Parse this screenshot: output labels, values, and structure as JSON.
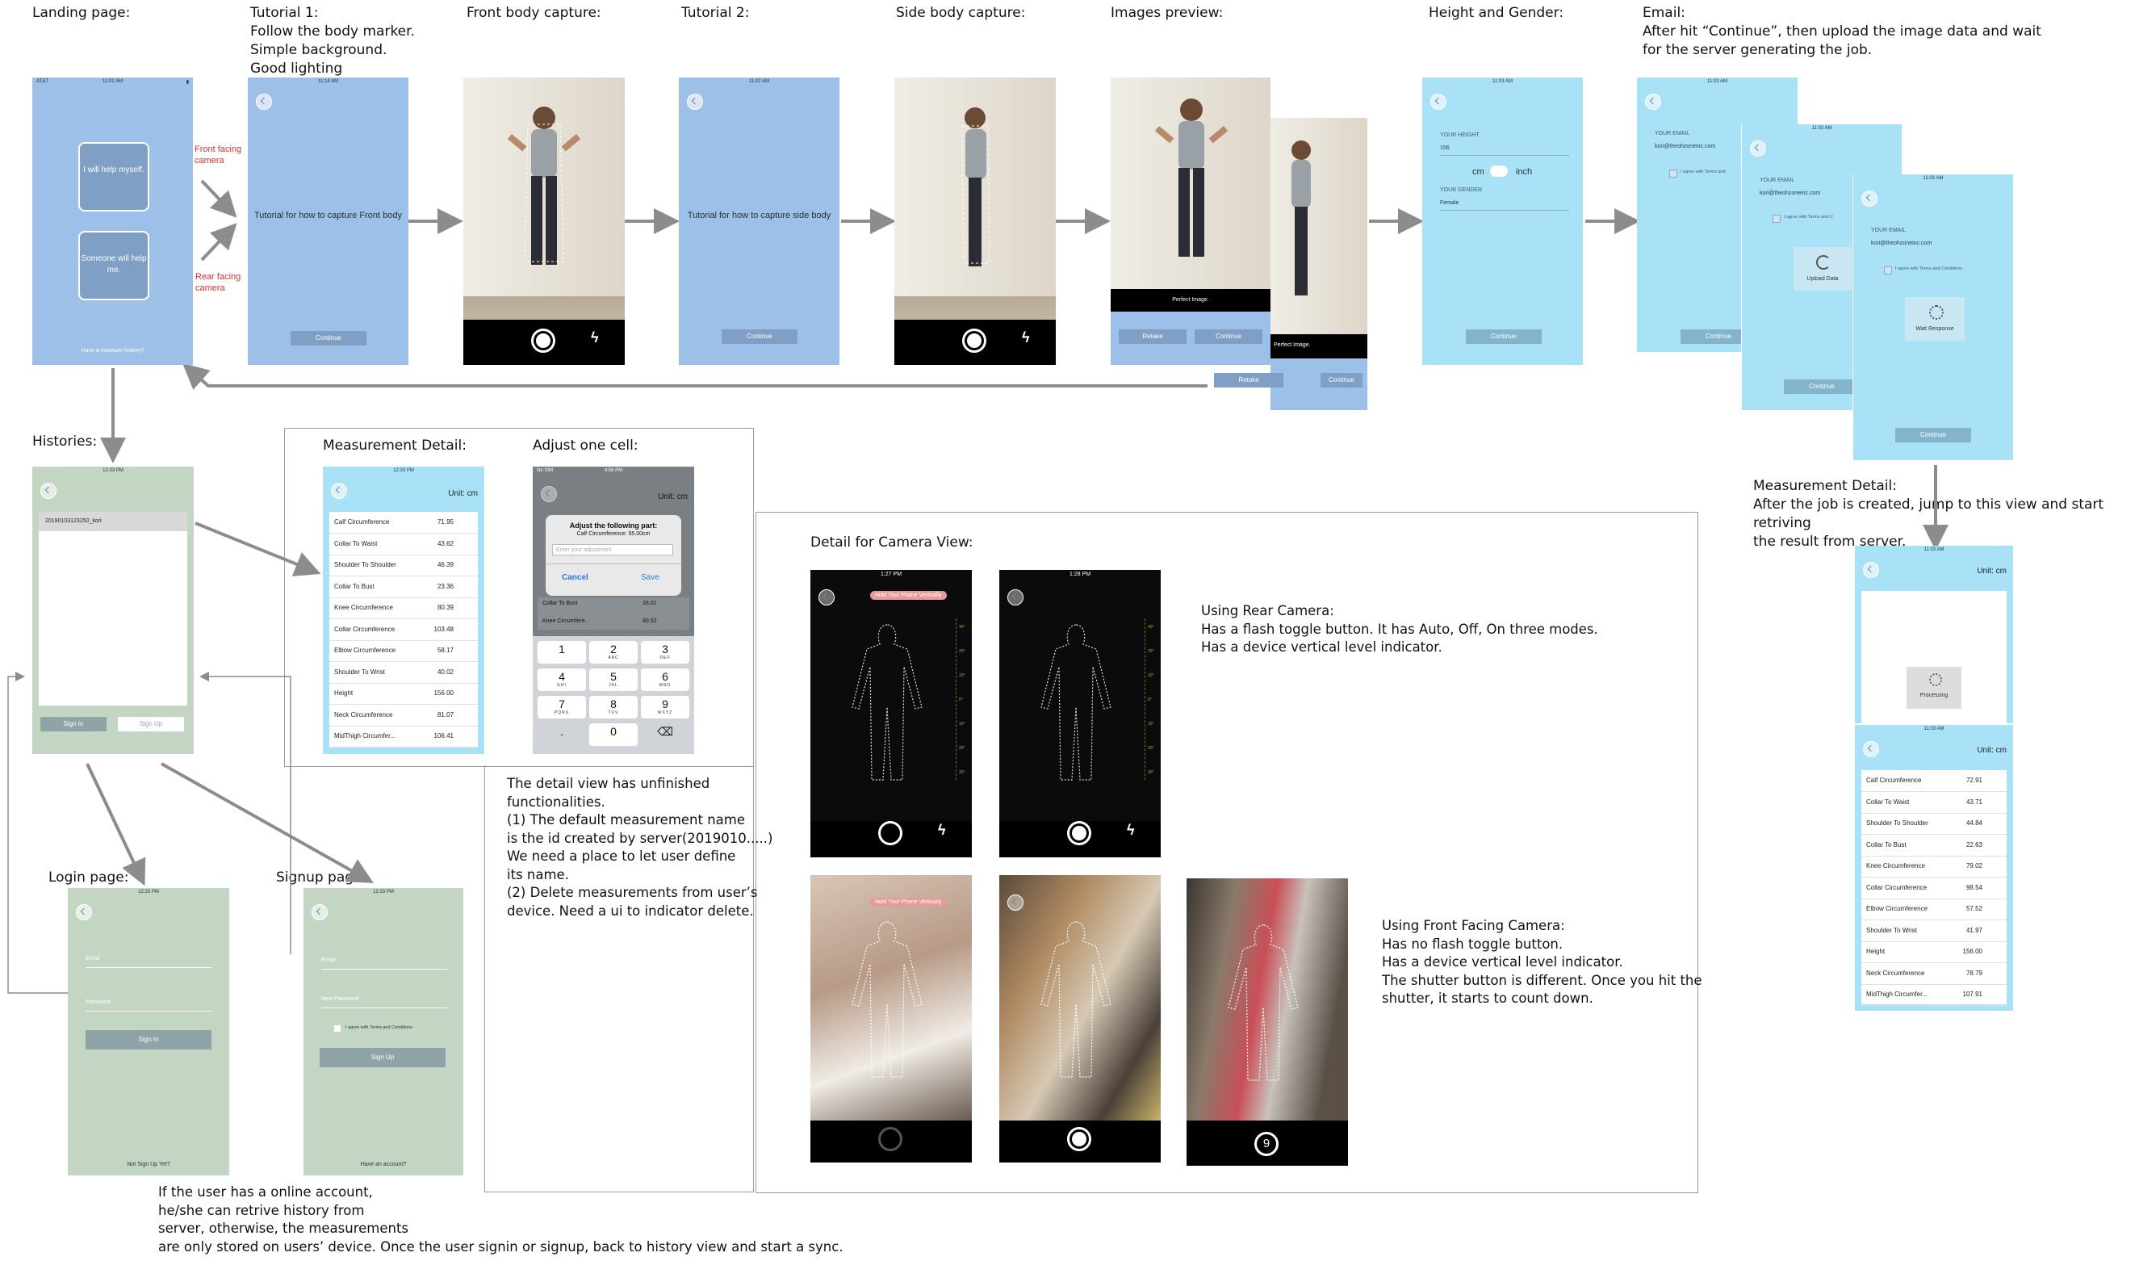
{
  "labels": {
    "landing": "Landing page:",
    "tutorial1": "Tutorial 1:\nFollow the body marker.\nSimple background.\nGood lighting",
    "front_capture": "Front body capture:",
    "tutorial2": "Tutorial 2:",
    "side_capture": "Side body capture:",
    "images_preview": "Images preview:",
    "height_gender": "Height and Gender:",
    "email": "Email:\nAfter hit “Continue”, then upload the image data and wait\nfor the server generating the job.",
    "histories": "Histories:",
    "measurement_detail": "Measurement Detail:",
    "adjust_cell": "Adjust one cell:",
    "camera_detail": "Detail for Camera View:",
    "measurement_detail_right": "Measurement Detail:\nAfter the job is created, jump to this view and start retriving\nthe result from server.",
    "login": "Login page:",
    "signup": "Signup page:",
    "front_facing": "Front facing\ncamera",
    "rear_facing": "Rear facing\ncamera"
  },
  "notes": {
    "detail_view": "The detail view has unfinished\nfunctionalities.\n(1) The default measurement name\nis the id created by server(2019010.....)\nWe need a place to let user define\nits name.\n(2) Delete measurements from user’s\ndevice. Need a ui to indicator delete.",
    "rear_camera": "Using Rear Camera:\nHas a flash toggle button. It has Auto, Off, On three modes.\nHas a device vertical level indicator.",
    "front_camera": "Using Front Facing Camera:\nHas no flash toggle button.\nHas a device vertical level indicator.\nThe shutter button is different. Once you hit the\nshutter, it starts to count down.",
    "online_account": "If the user has a online account,\nhe/she can retrive history from\nserver, otherwise, the measurements\nare only stored on users’ device. Once the user signin or signup, back to history view and start a sync."
  },
  "landing_screen": {
    "status_carrier": "AT&T",
    "status_time": "11:01 AM",
    "help_myself": "I will help\nmyself.",
    "someone_help": "Someone will\nhelp me.",
    "footer": "Have a measure history?"
  },
  "tutorial1_screen": {
    "status_time": "11:14 AM",
    "text": "Tutorial for how to\ncapture Front body",
    "button": "Continue"
  },
  "tutorial2_screen": {
    "status_time": "11:02 AM",
    "text": "Tutorial for how to\ncapture side body",
    "button": "Continue"
  },
  "front_capture_screen": {
    "status_time": "11:07 AM"
  },
  "side_capture_screen": {
    "status_time": "11:03 AM"
  },
  "preview_screen": {
    "caption": "Perfect Image.",
    "retake": "Retake",
    "continue": "Continue",
    "caption2": "Perfect Image.",
    "retake2": "Retake",
    "continue2": "Continue"
  },
  "height_screen": {
    "status_time": "11:03 AM",
    "height_label": "YOUR HEIGHT",
    "height_value": "156",
    "unit_cm": "cm",
    "unit_inch": "inch",
    "gender_label": "YOUR GENDER",
    "gender_value": "Female",
    "button": "Continue"
  },
  "email_screens": {
    "status_time": "11:03 AM",
    "email_label": "YOUR EMAIL",
    "email_value": "kori@theohzoneinc.com",
    "agree": "I agree with Terms and Conditions",
    "agree_short": "I agree with Terms and",
    "agree_mid": "I agree with Terms and C",
    "upload": "Upload Data",
    "wait": "Wait Response",
    "button": "Continue"
  },
  "histories_screen": {
    "status_time": "12:33 PM",
    "item": "20190103123250_kori",
    "sign_in": "Sign In",
    "sign_up": "Sign Up"
  },
  "measurement_screen": {
    "status_time": "12:33 PM",
    "unit": "Unit:  cm",
    "rows": [
      {
        "name": "Calf Circumference",
        "value": "71.95"
      },
      {
        "name": "Collar To Waist",
        "value": "43.62"
      },
      {
        "name": "Shoulder To Shoulder",
        "value": "46.39"
      },
      {
        "name": "Collar To Bust",
        "value": "23.36"
      },
      {
        "name": "Knee Circumference",
        "value": "80.39"
      },
      {
        "name": "Collar Circumference",
        "value": "103.48"
      },
      {
        "name": "Elbow Circumference",
        "value": "58.17"
      },
      {
        "name": "Shoulder To Wrist",
        "value": "40.02"
      },
      {
        "name": "Height",
        "value": "156.00"
      },
      {
        "name": "Neck Circumference",
        "value": "81.07"
      },
      {
        "name": "MidThigh Circumfer...",
        "value": "106.41"
      }
    ]
  },
  "adjust_screen": {
    "status_carrier": "No SIM",
    "status_time": "4:56 PM",
    "unit": "Unit:  cm",
    "title": "Adjust the following part:",
    "subtitle": "Calf Circumference: 55.00cm",
    "placeholder": "Enter your adjustment",
    "cancel": "Cancel",
    "save": "Save",
    "row1_name": "Collar To Bust",
    "row1_value": "28.01",
    "row2_name": "Knee Circumfere...",
    "row2_value": "80.52",
    "keys": [
      {
        "n": "1",
        "l": ""
      },
      {
        "n": "2",
        "l": "ABC"
      },
      {
        "n": "3",
        "l": "DEF"
      },
      {
        "n": "4",
        "l": "GHI"
      },
      {
        "n": "5",
        "l": "JKL"
      },
      {
        "n": "6",
        "l": "MNO"
      },
      {
        "n": "7",
        "l": "PQRS"
      },
      {
        "n": "8",
        "l": "TUV"
      },
      {
        "n": "9",
        "l": "WXYZ"
      },
      {
        "n": ".",
        "l": ""
      },
      {
        "n": "0",
        "l": ""
      },
      {
        "n": "⌫",
        "l": ""
      }
    ]
  },
  "camera_views": {
    "time1": "1:27 PM",
    "time2": "1:28 PM",
    "hold_msg": "Hold Your Phone Vertically",
    "countdown": "9",
    "ticks": [
      "30°",
      "20°",
      "10°",
      "0°",
      "10°",
      "20°",
      "30°"
    ]
  },
  "processing_screen": {
    "status_time": "11:03 AM",
    "unit": "Unit:  cm",
    "processing": "Processing"
  },
  "result_screen": {
    "status_time": "11:03 AM",
    "unit": "Unit:  cm",
    "rows": [
      {
        "name": "Calf Circumference",
        "value": "72.91"
      },
      {
        "name": "Collar To Waist",
        "value": "43.71"
      },
      {
        "name": "Shoulder To Shoulder",
        "value": "44.84"
      },
      {
        "name": "Collar To Bust",
        "value": "22.63"
      },
      {
        "name": "Knee Circumference",
        "value": "79.02"
      },
      {
        "name": "Collar Circumference",
        "value": "98.54"
      },
      {
        "name": "Elbow Circumference",
        "value": "57.52"
      },
      {
        "name": "Shoulder To Wrist",
        "value": "41.97"
      },
      {
        "name": "Height",
        "value": "156.00"
      },
      {
        "name": "Neck Circumference",
        "value": "78.79"
      },
      {
        "name": "MidThigh Circumfer...",
        "value": "107.91"
      }
    ]
  },
  "login_screen": {
    "status_time": "12:33 PM",
    "email": "Email",
    "password": "Password",
    "sign_in": "Sign In",
    "footer": "Not Sign Up Yet?"
  },
  "signup_screen": {
    "status_time": "12:33 PM",
    "email": "Email",
    "new_password": "New Password",
    "agree": "I agree with Terms and Conditions",
    "sign_up": "Sign Up",
    "footer": "Have an account?"
  },
  "colors": {
    "blue_screen": "#9dc0e8",
    "cyan_screen": "#a9e1f7",
    "green_screen": "#c3d5c3",
    "arrow": "#8c8c8c",
    "red_note": "#e03030"
  }
}
